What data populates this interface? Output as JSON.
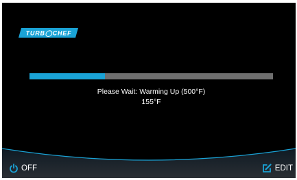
{
  "brand": {
    "logo_text": "TURBOCHEF",
    "color": "#1aa3d6"
  },
  "status": {
    "message": "Please Wait: Warming Up (500°F)",
    "current_temperature": "155°F",
    "progress_fraction": 0.31
  },
  "colors": {
    "accent": "#1aa3d6",
    "track": "#6f6f6f",
    "background": "#000000",
    "text": "#ffffff"
  },
  "footer": {
    "off_label": "OFF",
    "off_icon": "power-icon",
    "edit_label": "EDIT",
    "edit_icon": "edit-icon"
  }
}
